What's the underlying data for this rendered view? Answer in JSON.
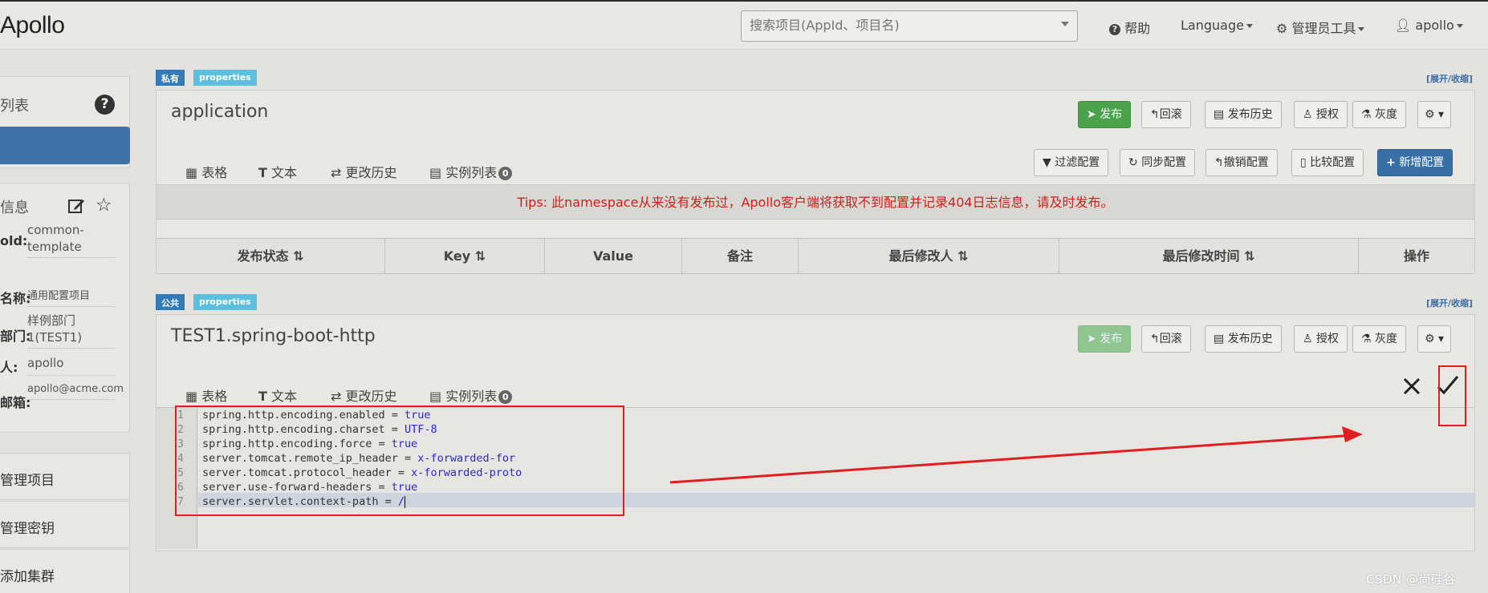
{
  "nav": {
    "logo": "Apollo",
    "search_placeholder": "搜索项目(AppId、项目名)",
    "help": "帮助",
    "language": "Language",
    "admin_tools": "管理员工具",
    "user": "apollo"
  },
  "sidebar": {
    "list_title": "列表",
    "info_title": "信息",
    "info": [
      {
        "key": "old:",
        "value": "common-template"
      },
      {
        "key": "名称:",
        "value": "通用配置项目"
      },
      {
        "key": "部门:",
        "value": "样例部门1(TEST1)"
      },
      {
        "key": "人:",
        "value": "apollo"
      },
      {
        "key": "邮箱:",
        "value": "apollo@acme.com"
      }
    ],
    "links": [
      "管理项目",
      "管理密钥",
      "添加集群"
    ]
  },
  "ns1": {
    "badge_scope": "私有",
    "badge_format": "properties",
    "toggle": "[展开/收缩]",
    "title": "application",
    "buttons": {
      "publish": "发布",
      "rollback": "回滚",
      "history": "发布历史",
      "grant": "授权",
      "gray": "灰度"
    },
    "tabs": {
      "table": "表格",
      "text": "文本",
      "history": "更改历史",
      "instances": "实例列表",
      "instance_count": "0"
    },
    "actions": {
      "filter": "过滤配置",
      "sync": "同步配置",
      "revoke": "撤销配置",
      "compare": "比较配置",
      "add": "新增配置"
    },
    "tips": "Tips: 此namespace从来没有发布过，Apollo客户端将获取不到配置并记录404日志信息，请及时发布。",
    "columns": [
      "发布状态",
      "Key",
      "Value",
      "备注",
      "最后修改人",
      "最后修改时间",
      "操作"
    ]
  },
  "ns2": {
    "badge_scope": "公共",
    "badge_format": "properties",
    "toggle": "[展开/收缩]",
    "title": "TEST1.spring-boot-http",
    "buttons": {
      "publish": "发布",
      "rollback": "回滚",
      "history": "发布历史",
      "grant": "授权",
      "gray": "灰度"
    },
    "tabs": {
      "table": "表格",
      "text": "文本",
      "history": "更改历史",
      "instances": "实例列表",
      "instance_count": "0"
    },
    "lines": [
      {
        "n": "1",
        "key": "spring.http.encoding.enabled",
        "val": "true"
      },
      {
        "n": "2",
        "key": "spring.http.encoding.charset",
        "val": "UTF-8"
      },
      {
        "n": "3",
        "key": "spring.http.encoding.force",
        "val": "true"
      },
      {
        "n": "4",
        "key": "server.tomcat.remote_ip_header",
        "val": "x-forwarded-for"
      },
      {
        "n": "5",
        "key": "server.tomcat.protocol_header",
        "val": "x-forwarded-proto"
      },
      {
        "n": "6",
        "key": "server.use-forward-headers",
        "val": "true"
      },
      {
        "n": "7",
        "key": "server.servlet.context-path",
        "val": "/"
      }
    ],
    "eq": " = "
  },
  "watermark": "CSDN @尚硅谷",
  "colors": {
    "primary": "#3a6fa5",
    "success": "#4aa34a",
    "danger": "#d0201a",
    "annotation": "#e02020"
  }
}
